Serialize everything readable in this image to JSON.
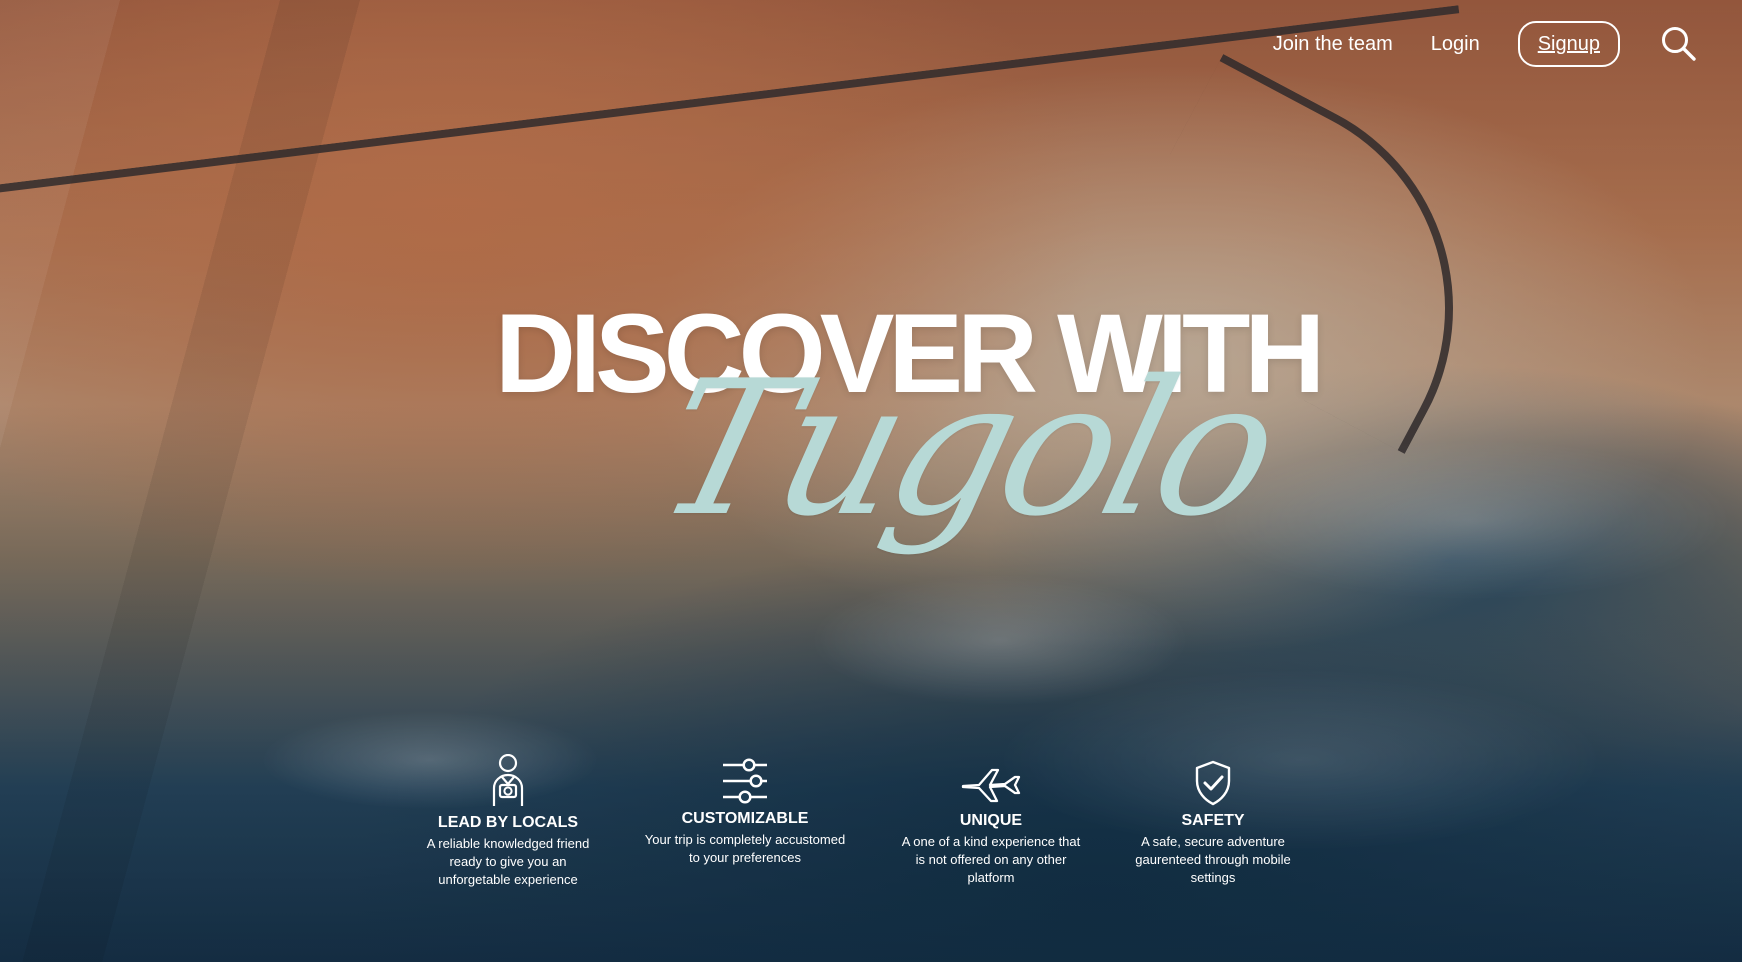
{
  "header": {
    "nav": {
      "join": "Join the team",
      "login": "Login",
      "signup": "Signup"
    },
    "icons": {
      "search": "search-icon"
    }
  },
  "hero": {
    "headline": "DISCOVER WITH",
    "brand": "Tugolo"
  },
  "features": [
    {
      "icon": "tour-guide-icon",
      "title": "LEAD BY LOCALS",
      "description": "A reliable knowledged friend ready to give you an unforgetable experience"
    },
    {
      "icon": "sliders-icon",
      "title": "CUSTOMIZABLE",
      "description": "Your trip is completely accustomed to your preferences"
    },
    {
      "icon": "airplane-icon",
      "title": "UNIQUE",
      "description": "A one of a kind experience that is not offered on any other platform"
    },
    {
      "icon": "shield-check-icon",
      "title": "SAFETY",
      "description": "A safe, secure adventure gaurenteed through mobile settings"
    }
  ],
  "colors": {
    "accent": "#b7d9d6",
    "text": "#ffffff"
  }
}
